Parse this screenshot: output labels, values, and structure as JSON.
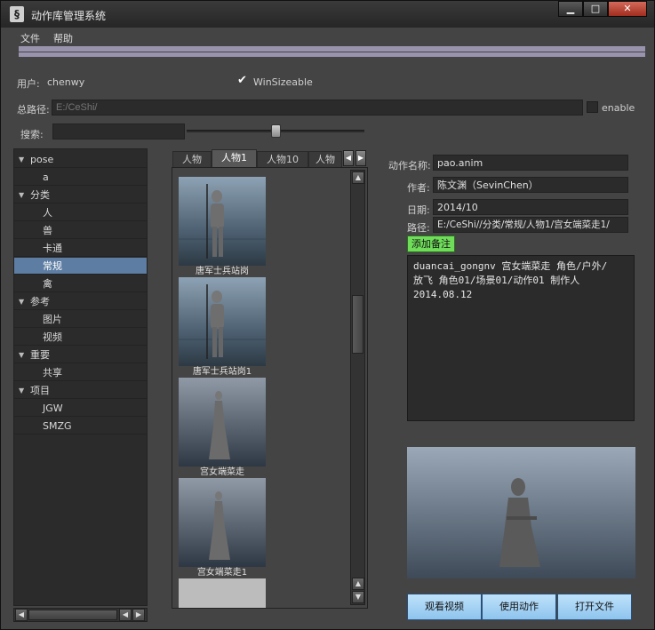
{
  "window": {
    "title": "动作库管理系统"
  },
  "menu": {
    "file": "文件",
    "help": "帮助"
  },
  "user": {
    "label": "用户:",
    "value": "chenwy"
  },
  "winsizeable": {
    "label": "WinSizeable",
    "checked": true
  },
  "path_total": {
    "label": "总路径:",
    "placeholder": "E:/CeShi/",
    "enable_label": "enable"
  },
  "search": {
    "label": "搜索:",
    "value": ""
  },
  "tree": [
    {
      "label": "pose",
      "level": 0,
      "expanded": true
    },
    {
      "label": "a",
      "level": 1
    },
    {
      "label": "分类",
      "level": 0,
      "expanded": true
    },
    {
      "label": "人",
      "level": 1
    },
    {
      "label": "兽",
      "level": 1
    },
    {
      "label": "卡通",
      "level": 1
    },
    {
      "label": "常规",
      "level": 1,
      "selected": true
    },
    {
      "label": "禽",
      "level": 1
    },
    {
      "label": "参考",
      "level": 0,
      "expanded": true
    },
    {
      "label": "图片",
      "level": 1
    },
    {
      "label": "视频",
      "level": 1
    },
    {
      "label": "重要",
      "level": 0,
      "expanded": true
    },
    {
      "label": "共享",
      "level": 1
    },
    {
      "label": "项目",
      "level": 0,
      "expanded": true
    },
    {
      "label": "JGW",
      "level": 1
    },
    {
      "label": "SMZG",
      "level": 1
    }
  ],
  "tabs": [
    "人物",
    "人物1",
    "人物10",
    "人物"
  ],
  "active_tab": "人物1",
  "thumbnails": [
    {
      "caption": "唐军士兵站岗"
    },
    {
      "caption": "唐军士兵站岗1"
    },
    {
      "caption": "宫女端菜走"
    },
    {
      "caption": "宫女端菜走1"
    }
  ],
  "details": {
    "name_label": "动作名称:",
    "name": "pao.anim",
    "author_label": "作者:",
    "author": "陈文渊（SevinChen）",
    "date_label": "日期:",
    "date": "2014/10",
    "path_label": "路径:",
    "path": "E:/CeShi//分类/常规/人物1/宫女端菜走1/"
  },
  "add_note_label": "添加备注",
  "description": "duancai_gongnv 宫女端菜走 角色/户外/\n放飞 角色01/场景01/动作01 制作人\n2014.08.12",
  "buttons": {
    "watch_video": "观看视频",
    "use_action": "使用动作",
    "open_file": "打开文件"
  },
  "colors": {
    "selection": "#5d7da2",
    "add_note": "#6fdc5a",
    "action_button": "#a7d3f4",
    "stripe": "#9a93ad"
  }
}
